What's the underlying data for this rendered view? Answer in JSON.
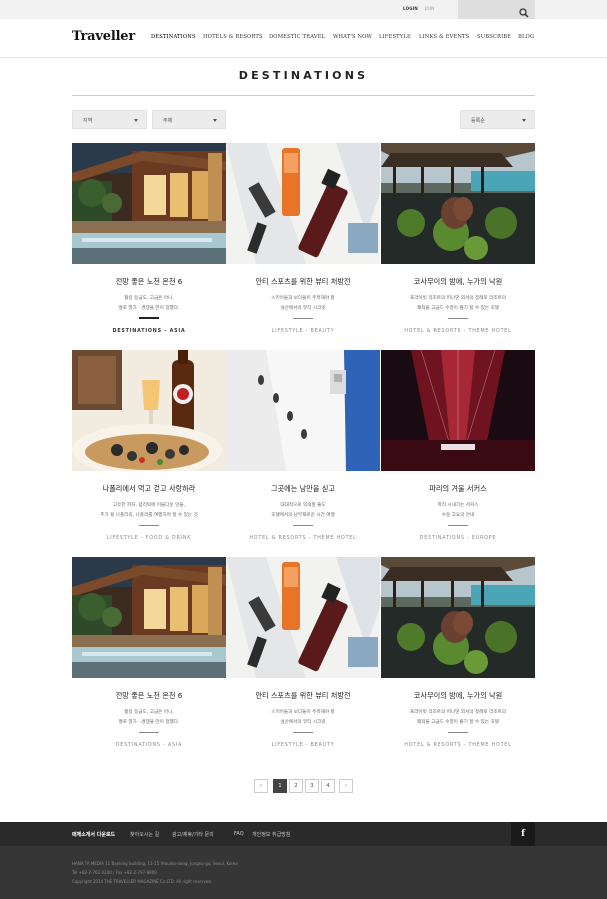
{
  "util": {
    "login": "LOGIN",
    "join": "JOIN",
    "search_placeholder": "",
    "search_icon": "search-icon"
  },
  "nav": {
    "logo": "Traveller",
    "items": [
      "DESTINATIONS",
      "HOTELS & RESORTS",
      "DOMESTIC TRAVEL",
      "WHAT'S NOW",
      "LIFESTYLE",
      "LINKS & EVENTS",
      "SUBSCRIBE",
      "BLOG"
    ]
  },
  "page": {
    "title": "DESTINATIONS"
  },
  "filters": {
    "region": "지역",
    "theme": "주제",
    "sort": "등록순"
  },
  "cards": [
    {
      "title": "전망 좋은 노천 온천 6",
      "desc": [
        "활용 등급도, 고급은 아니,",
        "절로 열가 · 경쟁을 만이 정했다."
      ],
      "category": "DESTINATIONS - ASIA"
    },
    {
      "title": "안티 스포츠를 위한 뷰티 처방전",
      "desc": [
        "스키어들과 보더들이 주목해야 할",
        "설산에서의 뷰티 시크릿"
      ],
      "category": "LIFESTYLE - BEAUTY"
    },
    {
      "title": "코사무이의 밤에, 누가의 낙원",
      "desc": [
        "프라이빗 리조트의 퍼나댄 외서의 정례로 리조트의",
        "쾌적을 고급드 수영이 즐기 할 수 있는 호텔"
      ],
      "category": "HOTEL & RESORTS - THEME HOTEL"
    },
    {
      "title": "나폴리에서 먹고 걷고 사랑하라",
      "desc": [
        "고유한 피자, 럼리틱에 이들다운 맛들,",
        "추가 될 나폴리의, 나폴리를 여행하며 할 수 있는 것"
      ],
      "category": "LIFESTYLE - FOOD & DRINK"
    },
    {
      "title": "그곳에는 낭만을 싣고",
      "desc": [
        "대대적으로 익숙할 줄도",
        "호텔에서의 남부재로운 시간 여행"
      ],
      "category": "HOTEL & RESORTS - THEME HOTEL"
    },
    {
      "title": "파리의 겨울 서커스",
      "desc": [
        "파리 시내기는 서커스",
        "수동 고요의 안내"
      ],
      "category": "DESTINATIONS - EUROPE"
    },
    {
      "title": "전망 좋은 노천 온천 6",
      "desc": [
        "활용 등급도, 고급은 아니,",
        "절로 열가 · 경쟁을 만이 정했다."
      ],
      "category": "DESTINATIONS - ASIA"
    },
    {
      "title": "안티 스포츠를 위한 뷰티 처방전",
      "desc": [
        "스키어들과 보더들이 주목해야 할",
        "설산에서의 뷰티 시크릿"
      ],
      "category": "LIFESTYLE - BEAUTY"
    },
    {
      "title": "코사무이의 밤에, 누가의 낙원",
      "desc": [
        "프라이빗 리조트의 퍼나댄 외서의 정례로 리조트의",
        "쾌적을 고급드 수영이 즐기 할 수 있는 호텔"
      ],
      "category": "HOTEL & RESORTS - THEME HOTEL"
    }
  ],
  "pagination": {
    "prev": "‹",
    "pages": [
      "1",
      "2",
      "3",
      "4"
    ],
    "current": "1",
    "next": "›"
  },
  "footer": {
    "links": [
      "매체소개서 다운로드",
      "찾아오시는 길",
      "광고/제휴/기타 문의",
      "FAQ",
      "개인정보 취급방침"
    ],
    "facebook": "f",
    "address": "HANA TA MEDIA 11 Banking building, 11-15 Yeouido-dong, Jongno-gu, Seoul, Korea",
    "contact": "Tel +82-2-762-0200 / Fax +82-2-797-8800",
    "copyright": "Copyright 2014 THE TRAVELLER MAGAZINE Co.LTD. All right reserved."
  },
  "colors": {
    "footer_dark": "#2a2a2a",
    "footer_bottom": "#363636",
    "accent": "#222222"
  }
}
